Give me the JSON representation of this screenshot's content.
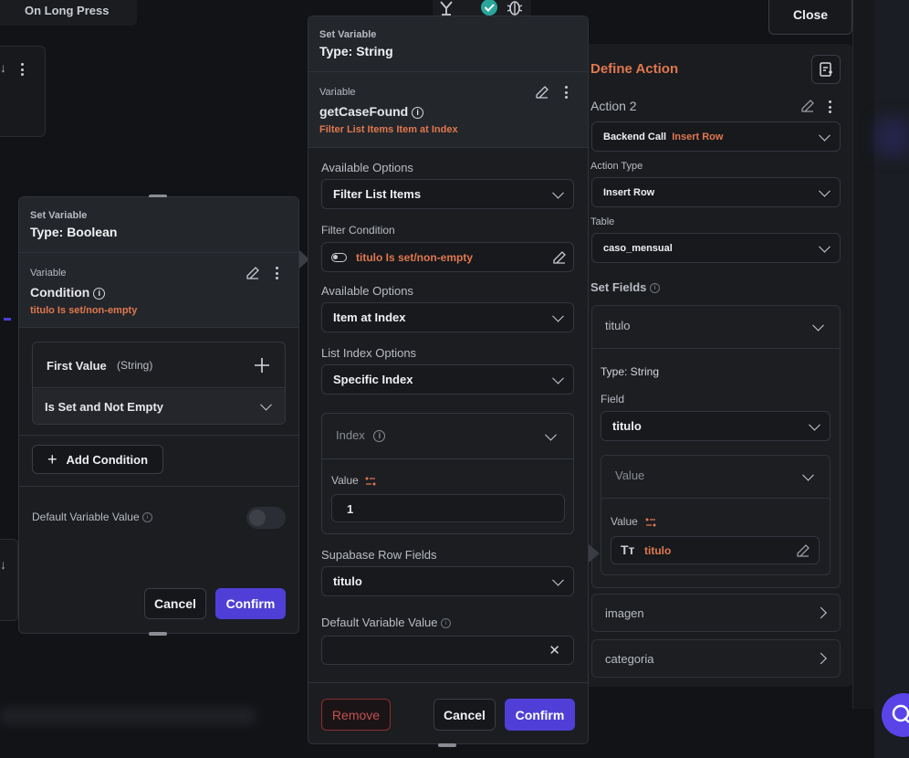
{
  "top": {
    "on_long_press": "On Long Press",
    "close": "Close"
  },
  "left_panel": {
    "header_small": "Set Variable",
    "header_type": "Type: Boolean",
    "variable_label": "Variable",
    "variable_name": "Condition",
    "variable_sub": "titulo Is set/non-empty",
    "first_value": "First Value",
    "first_value_type": "(String)",
    "condition_select": "Is Set and Not Empty",
    "add_condition": "Add Condition",
    "default_label": "Default Variable Value",
    "cancel": "Cancel",
    "confirm": "Confirm"
  },
  "middle_panel": {
    "header_small": "Set Variable",
    "header_type": "Type: String",
    "variable_label": "Variable",
    "variable_name": "getCaseFound",
    "variable_sub": "Filter List Items Item at Index",
    "available_options_1_label": "Available Options",
    "available_options_1": "Filter List Items",
    "filter_condition_label": "Filter Condition",
    "filter_condition": "titulo Is set/non-empty",
    "available_options_2_label": "Available Options",
    "available_options_2": "Item at Index",
    "list_index_label": "List Index Options",
    "list_index": "Specific Index",
    "index_header": "Index",
    "value_label": "Value",
    "value": "1",
    "supabase_label": "Supabase Row Fields",
    "supabase_value": "titulo",
    "default_label": "Default Variable Value",
    "default_value": "",
    "remove": "Remove",
    "cancel": "Cancel",
    "confirm": "Confirm"
  },
  "right_panel": {
    "title": "Define Action",
    "action_name": "Action 2",
    "backend_call": "Backend Call",
    "backend_call_type": "Insert Row",
    "action_type_label": "Action Type",
    "action_type": "Insert Row",
    "table_label": "Table",
    "table": "caso_mensual",
    "set_fields": "Set Fields",
    "field_titulo": "titulo",
    "type_string": "Type: String",
    "field_label": "Field",
    "field_value": "titulo",
    "value_header": "Value",
    "value_label": "Value",
    "value_text": "titulo",
    "field_imagen": "imagen",
    "field_categoria": "categoria"
  },
  "colors": {
    "accent": "#4f3fd6",
    "orange": "#e0784e",
    "remove": "#c55050",
    "teal_check": "#2aa59a"
  }
}
